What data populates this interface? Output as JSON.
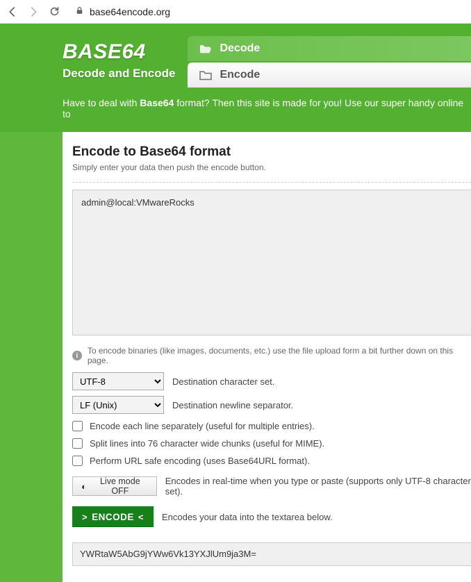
{
  "browser": {
    "url": "base64encode.org"
  },
  "header": {
    "logo_title": "BASE64",
    "logo_sub": "Decode and Encode",
    "tab_decode": "Decode",
    "tab_encode": "Encode",
    "intro_pre": "Have to deal with ",
    "intro_bold": "Base64",
    "intro_post": " format? Then this site is made for you! Use our super handy online to"
  },
  "main": {
    "title": "Encode to Base64 format",
    "subline": "Simply enter your data then push the encode button.",
    "input_value": "admin@local:VMwareRocks",
    "hint": "To encode binaries (like images, documents, etc.) use the file upload form a bit further down on this page.",
    "charset_select": "UTF-8",
    "charset_label": "Destination character set.",
    "newline_select": "LF (Unix)",
    "newline_label": "Destination newline separator.",
    "chk_eachline": "Encode each line separately (useful for multiple entries).",
    "chk_split76": "Split lines into 76 character wide chunks (useful for MIME).",
    "chk_urlsafe": "Perform URL safe encoding (uses Base64URL format).",
    "livemode_label": "Live mode OFF",
    "livemode_desc": "Encodes in real-time when you type or paste (supports only UTF-8 character set).",
    "encode_label": "ENCODE",
    "encode_desc": "Encodes your data into the textarea below.",
    "output_value": "YWRtaW5AbG9jYWw6Vk13YXJlUm9ja3M="
  }
}
